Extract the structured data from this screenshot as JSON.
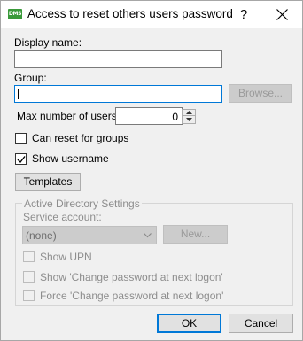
{
  "window": {
    "icon_text": "DMS",
    "title": "Access to reset others users password",
    "help_glyph": "?"
  },
  "form": {
    "display_name_label": "Display name:",
    "display_name_value": "",
    "group_label": "Group:",
    "group_value": "",
    "browse_label": "Browse...",
    "max_users_label": "Max number of users:",
    "max_users_value": "0",
    "can_reset_groups_label": "Can reset for groups",
    "can_reset_groups_checked": false,
    "show_username_label": "Show username",
    "show_username_checked": true,
    "templates_label": "Templates"
  },
  "ad_settings": {
    "title": "Active Directory Settings",
    "service_account_label": "Service account:",
    "service_account_value": "(none)",
    "new_label": "New...",
    "show_upn_label": "Show UPN",
    "show_change_pw_label": "Show 'Change password at next logon'",
    "force_change_pw_label": "Force 'Change password at next logon'"
  },
  "footer": {
    "ok_label": "OK",
    "cancel_label": "Cancel"
  }
}
